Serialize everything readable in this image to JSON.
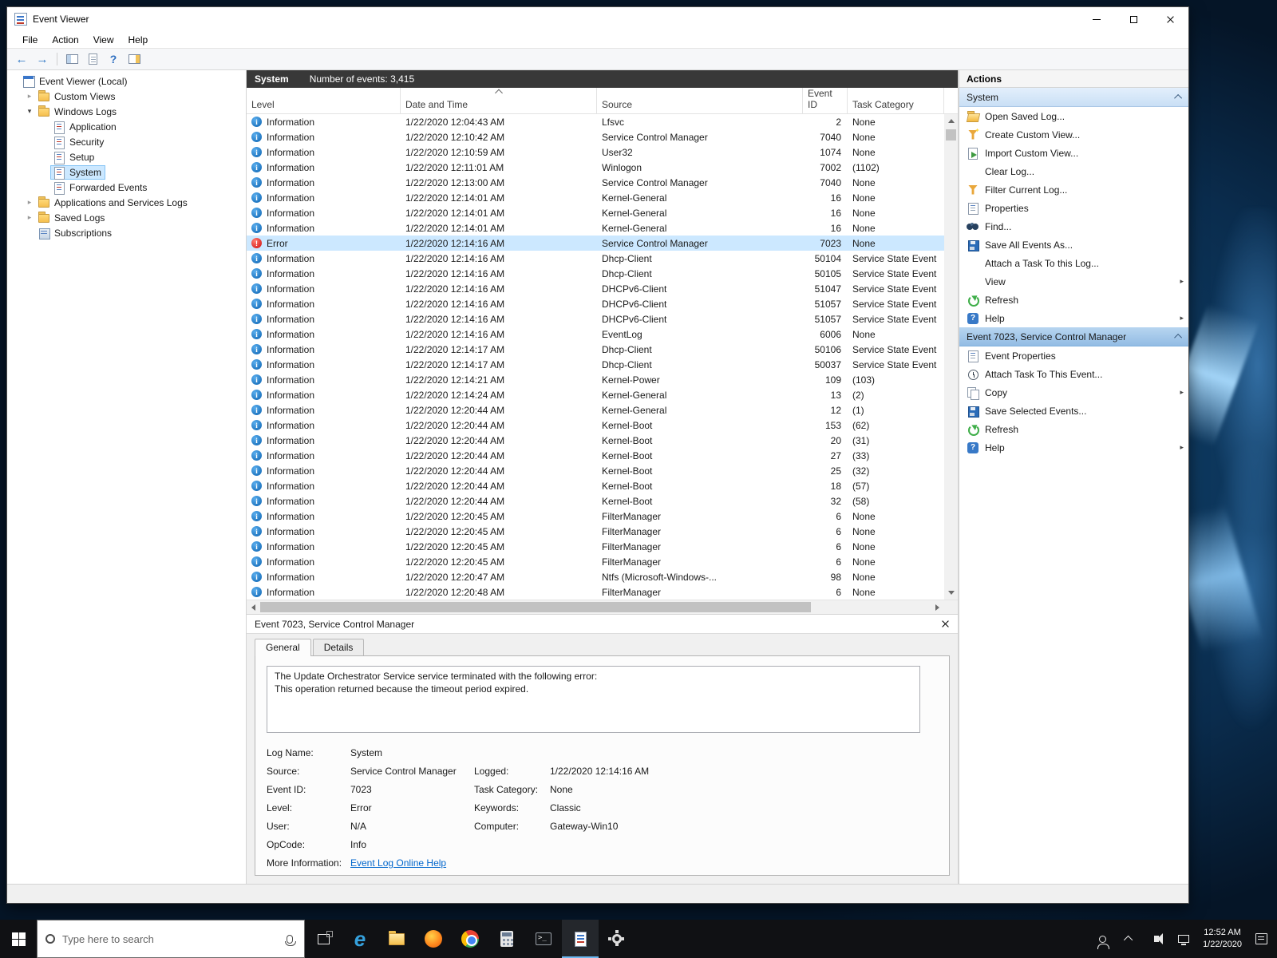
{
  "colors": {
    "accent": "#0078d7",
    "selection": "#cce8ff",
    "info_icon": "#0b62b0",
    "error_icon": "#cf0a0a",
    "taskbar": "#101114"
  },
  "window": {
    "title": "Event Viewer",
    "menu": [
      "File",
      "Action",
      "View",
      "Help"
    ]
  },
  "tree": {
    "items": [
      {
        "label": "Event Viewer (Local)",
        "indent": 0,
        "icon": "root",
        "twisty": ""
      },
      {
        "label": "Custom Views",
        "indent": 1,
        "icon": "folder",
        "twisty": "collapsed"
      },
      {
        "label": "Windows Logs",
        "indent": 1,
        "icon": "folder",
        "twisty": "expanded"
      },
      {
        "label": "Application",
        "indent": 2,
        "icon": "log",
        "twisty": ""
      },
      {
        "label": "Security",
        "indent": 2,
        "icon": "log",
        "twisty": ""
      },
      {
        "label": "Setup",
        "indent": 2,
        "icon": "log",
        "twisty": ""
      },
      {
        "label": "System",
        "indent": 2,
        "icon": "log",
        "twisty": "",
        "selected": true
      },
      {
        "label": "Forwarded Events",
        "indent": 2,
        "icon": "log",
        "twisty": ""
      },
      {
        "label": "Applications and Services Logs",
        "indent": 1,
        "icon": "folder",
        "twisty": "collapsed"
      },
      {
        "label": "Saved Logs",
        "indent": 1,
        "icon": "folder",
        "twisty": "collapsed"
      },
      {
        "label": "Subscriptions",
        "indent": 1,
        "icon": "subscriptions",
        "twisty": ""
      }
    ]
  },
  "list": {
    "title": "System",
    "count_text": "Number of events: 3,415",
    "columns": [
      "Level",
      "Date and Time",
      "Source",
      "Event ID",
      "Task Category"
    ],
    "sorted_column": "Date and Time",
    "rows": [
      {
        "level": "Information",
        "time": "1/22/2020 12:04:43 AM",
        "source": "Lfsvc",
        "id": "2",
        "cat": "None"
      },
      {
        "level": "Information",
        "time": "1/22/2020 12:10:42 AM",
        "source": "Service Control Manager",
        "id": "7040",
        "cat": "None"
      },
      {
        "level": "Information",
        "time": "1/22/2020 12:10:59 AM",
        "source": "User32",
        "id": "1074",
        "cat": "None"
      },
      {
        "level": "Information",
        "time": "1/22/2020 12:11:01 AM",
        "source": "Winlogon",
        "id": "7002",
        "cat": "(1102)"
      },
      {
        "level": "Information",
        "time": "1/22/2020 12:13:00 AM",
        "source": "Service Control Manager",
        "id": "7040",
        "cat": "None"
      },
      {
        "level": "Information",
        "time": "1/22/2020 12:14:01 AM",
        "source": "Kernel-General",
        "id": "16",
        "cat": "None"
      },
      {
        "level": "Information",
        "time": "1/22/2020 12:14:01 AM",
        "source": "Kernel-General",
        "id": "16",
        "cat": "None"
      },
      {
        "level": "Information",
        "time": "1/22/2020 12:14:01 AM",
        "source": "Kernel-General",
        "id": "16",
        "cat": "None"
      },
      {
        "level": "Error",
        "time": "1/22/2020 12:14:16 AM",
        "source": "Service Control Manager",
        "id": "7023",
        "cat": "None",
        "selected": true
      },
      {
        "level": "Information",
        "time": "1/22/2020 12:14:16 AM",
        "source": "Dhcp-Client",
        "id": "50104",
        "cat": "Service State Event"
      },
      {
        "level": "Information",
        "time": "1/22/2020 12:14:16 AM",
        "source": "Dhcp-Client",
        "id": "50105",
        "cat": "Service State Event"
      },
      {
        "level": "Information",
        "time": "1/22/2020 12:14:16 AM",
        "source": "DHCPv6-Client",
        "id": "51047",
        "cat": "Service State Event"
      },
      {
        "level": "Information",
        "time": "1/22/2020 12:14:16 AM",
        "source": "DHCPv6-Client",
        "id": "51057",
        "cat": "Service State Event"
      },
      {
        "level": "Information",
        "time": "1/22/2020 12:14:16 AM",
        "source": "DHCPv6-Client",
        "id": "51057",
        "cat": "Service State Event"
      },
      {
        "level": "Information",
        "time": "1/22/2020 12:14:16 AM",
        "source": "EventLog",
        "id": "6006",
        "cat": "None"
      },
      {
        "level": "Information",
        "time": "1/22/2020 12:14:17 AM",
        "source": "Dhcp-Client",
        "id": "50106",
        "cat": "Service State Event"
      },
      {
        "level": "Information",
        "time": "1/22/2020 12:14:17 AM",
        "source": "Dhcp-Client",
        "id": "50037",
        "cat": "Service State Event"
      },
      {
        "level": "Information",
        "time": "1/22/2020 12:14:21 AM",
        "source": "Kernel-Power",
        "id": "109",
        "cat": "(103)"
      },
      {
        "level": "Information",
        "time": "1/22/2020 12:14:24 AM",
        "source": "Kernel-General",
        "id": "13",
        "cat": "(2)"
      },
      {
        "level": "Information",
        "time": "1/22/2020 12:20:44 AM",
        "source": "Kernel-General",
        "id": "12",
        "cat": "(1)"
      },
      {
        "level": "Information",
        "time": "1/22/2020 12:20:44 AM",
        "source": "Kernel-Boot",
        "id": "153",
        "cat": "(62)"
      },
      {
        "level": "Information",
        "time": "1/22/2020 12:20:44 AM",
        "source": "Kernel-Boot",
        "id": "20",
        "cat": "(31)"
      },
      {
        "level": "Information",
        "time": "1/22/2020 12:20:44 AM",
        "source": "Kernel-Boot",
        "id": "27",
        "cat": "(33)"
      },
      {
        "level": "Information",
        "time": "1/22/2020 12:20:44 AM",
        "source": "Kernel-Boot",
        "id": "25",
        "cat": "(32)"
      },
      {
        "level": "Information",
        "time": "1/22/2020 12:20:44 AM",
        "source": "Kernel-Boot",
        "id": "18",
        "cat": "(57)"
      },
      {
        "level": "Information",
        "time": "1/22/2020 12:20:44 AM",
        "source": "Kernel-Boot",
        "id": "32",
        "cat": "(58)"
      },
      {
        "level": "Information",
        "time": "1/22/2020 12:20:45 AM",
        "source": "FilterManager",
        "id": "6",
        "cat": "None"
      },
      {
        "level": "Information",
        "time": "1/22/2020 12:20:45 AM",
        "source": "FilterManager",
        "id": "6",
        "cat": "None"
      },
      {
        "level": "Information",
        "time": "1/22/2020 12:20:45 AM",
        "source": "FilterManager",
        "id": "6",
        "cat": "None"
      },
      {
        "level": "Information",
        "time": "1/22/2020 12:20:45 AM",
        "source": "FilterManager",
        "id": "6",
        "cat": "None"
      },
      {
        "level": "Information",
        "time": "1/22/2020 12:20:47 AM",
        "source": "Ntfs (Microsoft-Windows-...",
        "id": "98",
        "cat": "None"
      },
      {
        "level": "Information",
        "time": "1/22/2020 12:20:48 AM",
        "source": "FilterManager",
        "id": "6",
        "cat": "None"
      }
    ]
  },
  "detail": {
    "title": "Event 7023, Service Control Manager",
    "tabs": [
      "General",
      "Details"
    ],
    "active_tab": "General",
    "message": [
      "The Update Orchestrator Service service terminated with the following error:",
      "This operation returned because the timeout period expired."
    ],
    "fields": [
      {
        "l1": "Log Name:",
        "v1": "System",
        "l2": "",
        "v2": ""
      },
      {
        "l1": "Source:",
        "v1": "Service Control Manager",
        "l2": "Logged:",
        "v2": "1/22/2020 12:14:16 AM"
      },
      {
        "l1": "Event ID:",
        "v1": "7023",
        "l2": "Task Category:",
        "v2": "None"
      },
      {
        "l1": "Level:",
        "v1": "Error",
        "l2": "Keywords:",
        "v2": "Classic"
      },
      {
        "l1": "User:",
        "v1": "N/A",
        "l2": "Computer:",
        "v2": "Gateway-Win10"
      },
      {
        "l1": "OpCode:",
        "v1": "Info",
        "l2": "",
        "v2": ""
      },
      {
        "l1": "More Information:",
        "v1": "Event Log Online Help",
        "link": true,
        "l2": "",
        "v2": ""
      }
    ]
  },
  "actions": {
    "title": "Actions",
    "groups": [
      {
        "header": "System",
        "selected": false,
        "items": [
          {
            "label": "Open Saved Log...",
            "icon": "open-folder"
          },
          {
            "label": "Create Custom View...",
            "icon": "create-filter"
          },
          {
            "label": "Import Custom View...",
            "icon": "import"
          },
          {
            "label": "Clear Log...",
            "icon": "none"
          },
          {
            "label": "Filter Current Log...",
            "icon": "filter"
          },
          {
            "label": "Properties",
            "icon": "properties"
          },
          {
            "label": "Find...",
            "icon": "find"
          },
          {
            "label": "Save All Events As...",
            "icon": "save"
          },
          {
            "label": "Attach a Task To this Log...",
            "icon": "none"
          },
          {
            "label": "View",
            "icon": "none",
            "submenu": true
          },
          {
            "label": "Refresh",
            "icon": "refresh"
          },
          {
            "label": "Help",
            "icon": "help",
            "submenu": true
          }
        ]
      },
      {
        "header": "Event 7023, Service Control Manager",
        "selected": true,
        "items": [
          {
            "label": "Event Properties",
            "icon": "event-properties"
          },
          {
            "label": "Attach Task To This Event...",
            "icon": "task"
          },
          {
            "label": "Copy",
            "icon": "copy",
            "submenu": true
          },
          {
            "label": "Save Selected Events...",
            "icon": "save"
          },
          {
            "label": "Refresh",
            "icon": "refresh"
          },
          {
            "label": "Help",
            "icon": "help",
            "submenu": true
          }
        ]
      }
    ]
  },
  "taskbar": {
    "search_placeholder": "Type here to search",
    "apps": [
      {
        "name": "edge"
      },
      {
        "name": "file-explorer"
      },
      {
        "name": "firefox"
      },
      {
        "name": "chrome"
      },
      {
        "name": "calculator"
      },
      {
        "name": "terminal"
      },
      {
        "name": "event-viewer",
        "active": true
      },
      {
        "name": "settings"
      }
    ],
    "tray_time": "12:52 AM",
    "tray_date": "1/22/2020"
  }
}
